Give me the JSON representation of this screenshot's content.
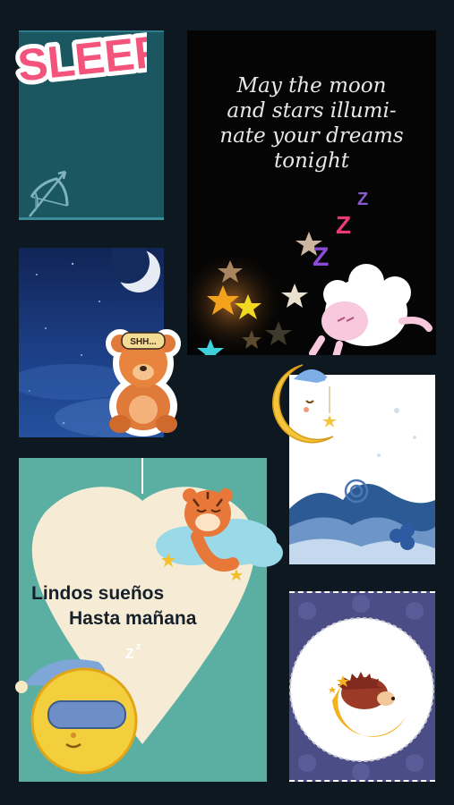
{
  "sticker_sleep": {
    "text": "SLEEP"
  },
  "card_moon_stars": {
    "lines": [
      "May the moon",
      "and stars illumi-",
      "nate your dreams",
      "tonight"
    ]
  },
  "bear_sticker": {
    "mask_text": "SHH..."
  },
  "card_lindos": {
    "line1": "Lindos sueños",
    "line2": "Hasta mañana"
  },
  "colors": {
    "background": "#0d1820",
    "teal_card": "#1b5760",
    "mint_card": "#5bafa2",
    "heart": "#f6ecd5",
    "navy_night": "#13306a",
    "purple_pattern": "#4b4e86",
    "sleep_pink": "#f4547c"
  },
  "icons": [
    "bow-and-arrow-icon",
    "moon-icon",
    "star-icon",
    "zzz-icon",
    "sheep-icon",
    "teddy-bear-icon",
    "tiger-icon",
    "hedgehog-icon",
    "cloud-icon"
  ]
}
